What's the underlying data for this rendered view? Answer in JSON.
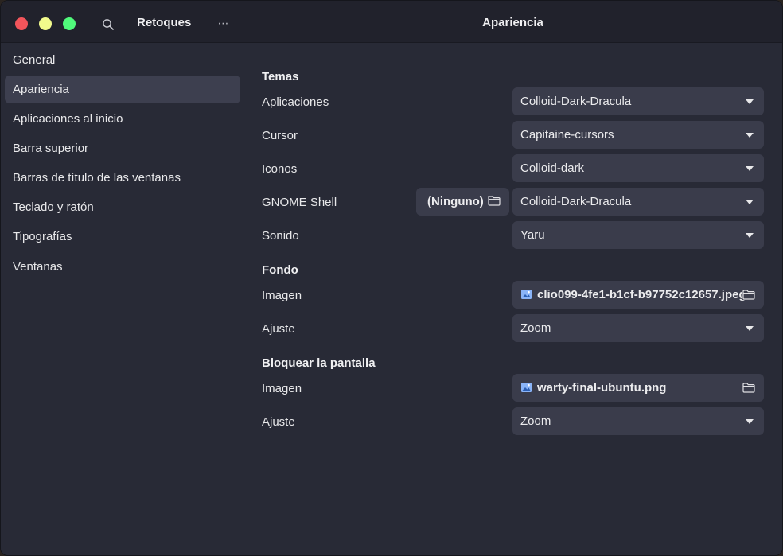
{
  "titlebar": {
    "app_title": "Retoques",
    "page_title": "Apariencia",
    "menu_glyph": "⋯"
  },
  "sidebar": {
    "items": [
      {
        "label": "General",
        "active": false
      },
      {
        "label": "Apariencia",
        "active": true
      },
      {
        "label": "Aplicaciones al inicio",
        "active": false
      },
      {
        "label": "Barra superior",
        "active": false
      },
      {
        "label": "Barras de título de las ventanas",
        "active": false
      },
      {
        "label": "Teclado y ratón",
        "active": false
      },
      {
        "label": "Tipografías",
        "active": false
      },
      {
        "label": "Ventanas",
        "active": false
      }
    ]
  },
  "themes": {
    "heading": "Temas",
    "applications": {
      "label": "Aplicaciones",
      "value": "Colloid-Dark-Dracula"
    },
    "cursor": {
      "label": "Cursor",
      "value": "Capitaine-cursors"
    },
    "icons": {
      "label": "Iconos",
      "value": "Colloid-dark"
    },
    "shell": {
      "label": "GNOME Shell",
      "file_button": "(Ninguno)",
      "value": "Colloid-Dark-Dracula"
    },
    "sound": {
      "label": "Sonido",
      "value": "Yaru"
    }
  },
  "background": {
    "heading": "Fondo",
    "image": {
      "label": "Imagen",
      "value": "clio099-4fe1-b1cf-b97752c12657.jpeg"
    },
    "adjust": {
      "label": "Ajuste",
      "value": "Zoom"
    }
  },
  "lockscreen": {
    "heading": "Bloquear la pantalla",
    "image": {
      "label": "Imagen",
      "value": "warty-final-ubuntu.png"
    },
    "adjust": {
      "label": "Ajuste",
      "value": "Zoom"
    }
  },
  "colors": {
    "window_bg": "#282a36",
    "titlebar_bg": "#21222c",
    "control_bg": "#3a3c4b",
    "close": "#f2555b",
    "minimize": "#f1fa8c",
    "maximize": "#50fa7b"
  }
}
